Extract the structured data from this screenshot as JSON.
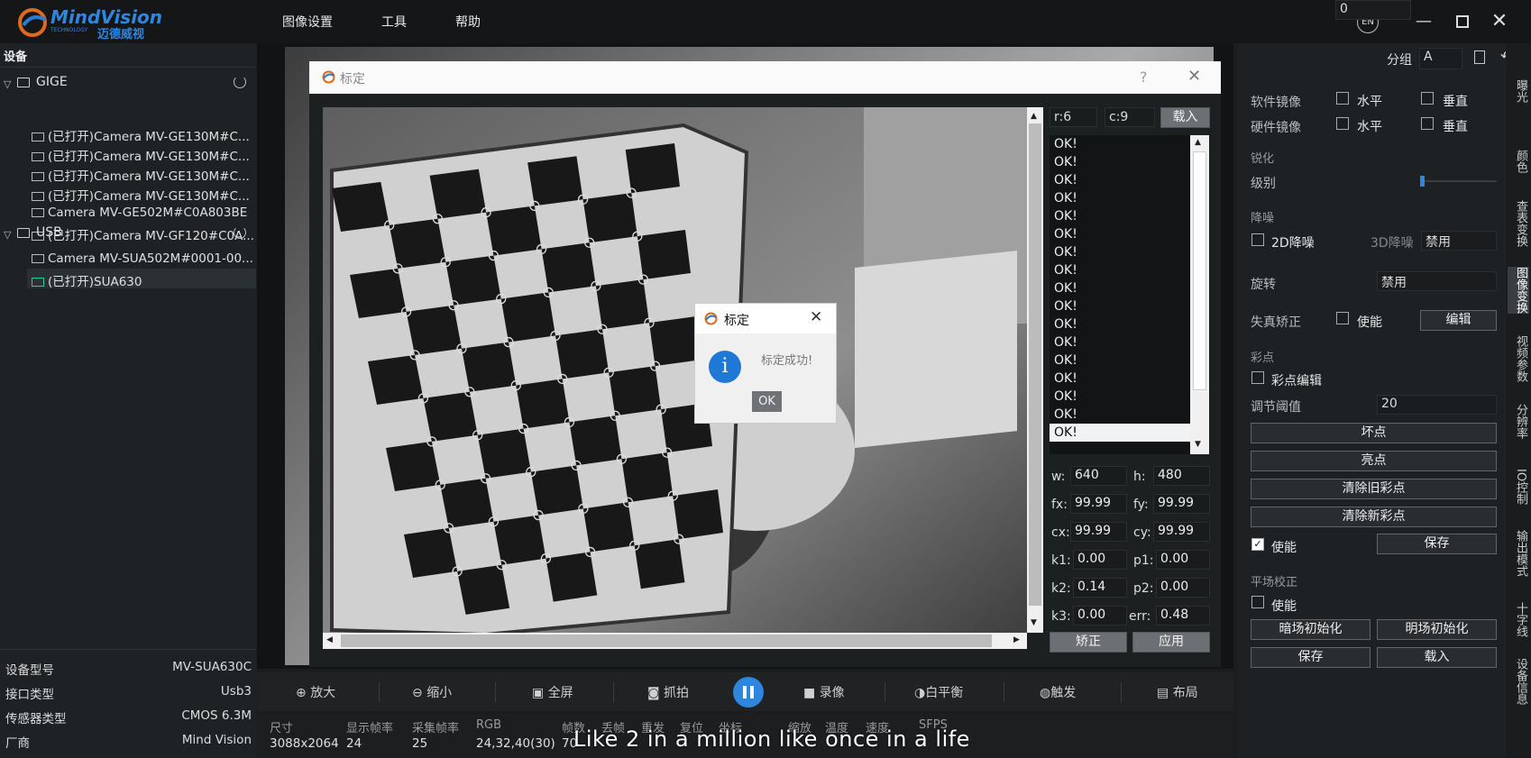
{
  "app": {
    "logo_name": "MindVision",
    "logo_sub": "TECHNOLOGY",
    "logo_cn": "迈德威视",
    "lang": "EN",
    "menu": [
      "图像设置",
      "工具",
      "帮助"
    ]
  },
  "devices": {
    "header": "设备",
    "gige_label": "GIGE",
    "usb_label": "USB",
    "gige": [
      "(已打开)Camera MV-GE130M#C...",
      "(已打开)Camera MV-GE130M#C...",
      "(已打开)Camera MV-GE130M#C...",
      "(已打开)Camera MV-GE130M#C...",
      "Camera MV-GE502M#C0A803BE",
      "(已打开)Camera MV-GF120#C0A..."
    ],
    "usb": [
      "Camera MV-SUA502M#0001-00...",
      "(已打开)SUA630"
    ]
  },
  "info": {
    "rows": [
      {
        "label": "设备型号",
        "value": "MV-SUA630C"
      },
      {
        "label": "接口类型",
        "value": "Usb3"
      },
      {
        "label": "传感器类型",
        "value": "CMOS 6.3M"
      },
      {
        "label": "厂商",
        "value": "Mind Vision"
      }
    ]
  },
  "calib": {
    "title": "标定",
    "help": "?",
    "rows_field": "r:6",
    "cols_field": "c:9",
    "load_btn": "载入",
    "ok_items": [
      "OK!",
      "OK!",
      "OK!",
      "OK!",
      "OK!",
      "OK!",
      "OK!",
      "OK!",
      "OK!",
      "OK!",
      "OK!",
      "OK!",
      "OK!",
      "OK!",
      "OK!",
      "OK!",
      "OK!"
    ],
    "params": [
      {
        "l1": "w:",
        "v1": "640",
        "l2": "h:",
        "v2": "480"
      },
      {
        "l1": "fx:",
        "v1": "99.99",
        "l2": "fy:",
        "v2": "99.99"
      },
      {
        "l1": "cx:",
        "v1": "99.99",
        "l2": "cy:",
        "v2": "99.99"
      },
      {
        "l1": "k1:",
        "v1": "0.00",
        "l2": "p1:",
        "v2": "0.00"
      },
      {
        "l1": "k2:",
        "v1": "0.14",
        "l2": "p2:",
        "v2": "0.00"
      },
      {
        "l1": "k3:",
        "v1": "0.00",
        "l2": "err:",
        "v2": "0.48"
      }
    ],
    "correct_btn": "矫正",
    "apply_btn": "应用"
  },
  "success": {
    "title": "标定",
    "message": "标定成功!",
    "ok": "OK"
  },
  "right": {
    "group_label": "分组",
    "group_value": "A",
    "sw_mirror": "软件镜像",
    "hw_mirror": "硬件镜像",
    "horizontal": "水平",
    "vertical": "垂直",
    "sharpen": "锐化",
    "level": "级别",
    "level_value": "0",
    "denoise": "降噪",
    "d2": "2D降噪",
    "d3": "3D降噪",
    "d3_value": "禁用",
    "rotate": "旋转",
    "rotate_value": "禁用",
    "distort": "失真矫正",
    "enable": "使能",
    "edit": "编辑",
    "color_point": "彩点",
    "cp_edit": "彩点编辑",
    "threshold": "调节阈值",
    "threshold_value": "20",
    "bad": "坏点",
    "bright": "亮点",
    "clear_old": "清除旧彩点",
    "clear_new": "清除新彩点",
    "save": "保存",
    "flat": "平场校正",
    "dark_init": "暗场初始化",
    "light_init": "明场初始化",
    "load": "载入",
    "tabs": [
      "曝光",
      "颜色",
      "查表变换",
      "图像变换",
      "视频参数",
      "分辨率",
      "IO控制",
      "输出模式",
      "十字线",
      "设备信息"
    ]
  },
  "toolbar": {
    "zoom_in": "放大",
    "zoom_out": "缩小",
    "full": "全屏",
    "snap": "抓拍",
    "record": "录像",
    "wb": "白平衡",
    "trigger": "触发",
    "layout": "布局"
  },
  "status": {
    "headers": [
      "尺寸",
      "显示帧率",
      "采集帧率",
      "RGB",
      "帧数",
      "丢帧",
      "重发",
      "复位",
      "坐标",
      "缩放",
      "温度",
      "速度",
      "SFPS"
    ],
    "values": [
      "3088x2064",
      "24",
      "25",
      "24,32,40(30)",
      "70"
    ],
    "subtitle": "Like 2 in a million like once in a life"
  }
}
